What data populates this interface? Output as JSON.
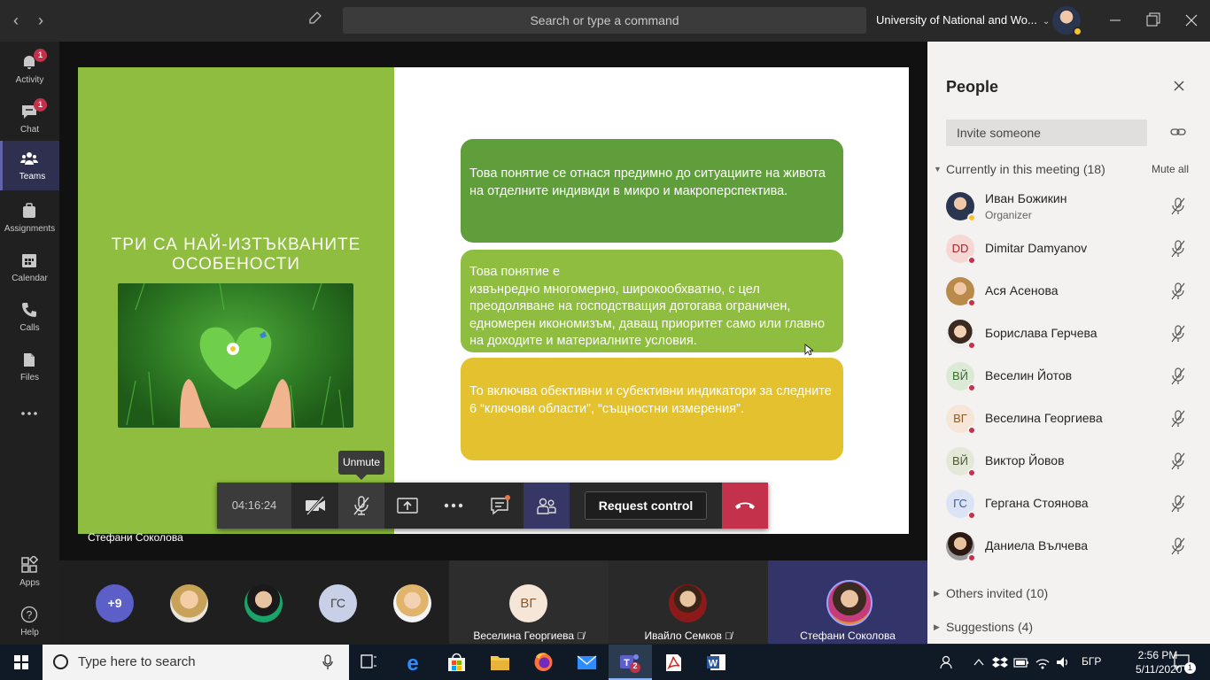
{
  "titlebar": {
    "search_placeholder": "Search or type a command",
    "org_name": "University of National and Wo...",
    "icons": [
      "back-arrow-icon",
      "forward-arrow-icon",
      "compose-icon",
      "chevron-down-icon",
      "minimize-icon",
      "restore-icon",
      "close-icon"
    ]
  },
  "rail": {
    "items": [
      {
        "label": "Activity",
        "badge": "1",
        "icon": "bell-icon"
      },
      {
        "label": "Chat",
        "badge": "1",
        "icon": "chat-icon"
      },
      {
        "label": "Teams",
        "icon": "teams-icon",
        "active": true
      },
      {
        "label": "Assignments",
        "icon": "assignments-icon"
      },
      {
        "label": "Calendar",
        "icon": "calendar-icon"
      },
      {
        "label": "Calls",
        "icon": "phone-icon"
      },
      {
        "label": "Files",
        "icon": "files-icon"
      },
      {
        "label": "",
        "icon": "more-icon"
      },
      {
        "label": "Apps",
        "icon": "apps-icon"
      },
      {
        "label": "Help",
        "icon": "help-icon"
      }
    ]
  },
  "slide": {
    "title": "ТРИ СА НАЙ-ИЗТЪКВАНИТЕ ОСОБЕНОСТИ",
    "box1": "Това понятие се отнася предимно до ситуациите на живота на отделните индивиди в микро и макроперспектива.",
    "box2_line1": "Това понятие е",
    "box2_rest": "извънредно многомерно, широкообхватно, с цел преодоляване на господстващия дотогава ограничен, едномерен икономизъм, даващ приоритет само или главно на доходите и материалните условия.",
    "box3": "То включва обективни и субективни индикатори за следните 6 “ключови области”, “същностни измерения”."
  },
  "presenter_name": "Стефани Соколова",
  "tooltip": "Unmute",
  "controls": {
    "timer": "04:16:24",
    "request_control": "Request control"
  },
  "strip": {
    "more_count": "+9",
    "gs_initials": "ГС",
    "tiles": [
      {
        "initials": "ВГ",
        "name": "Веселина Георгиева"
      },
      {
        "name": "Ивайло Семков"
      },
      {
        "name": "Стефани Соколова"
      }
    ]
  },
  "people": {
    "title": "People",
    "invite_placeholder": "Invite someone",
    "current_section": "Currently in this meeting (18)",
    "mute_all": "Mute all",
    "others_invited": "Others invited (10)",
    "suggestions": "Suggestions (4)",
    "participants": [
      {
        "name": "Иван Божикин",
        "role": "Organizer",
        "status": "away"
      },
      {
        "name": "Dimitar Damyanov",
        "initials": "DD"
      },
      {
        "name": "Ася Асенова"
      },
      {
        "name": "Борислава Герчева"
      },
      {
        "name": "Веселин Йотов",
        "initials": "ВЙ"
      },
      {
        "name": "Веселина Георгиева",
        "initials": "ВГ"
      },
      {
        "name": "Виктор Йовов",
        "initials": "ВЙ"
      },
      {
        "name": "Гергана Стоянова",
        "initials": "ГС"
      },
      {
        "name": "Даниела Вълчева"
      }
    ]
  },
  "taskbar": {
    "search_placeholder": "Type here to search",
    "teams_badge": "2",
    "language": "БГР",
    "time": "2:56 PM",
    "date": "5/11/2020",
    "notification_count": "1"
  }
}
